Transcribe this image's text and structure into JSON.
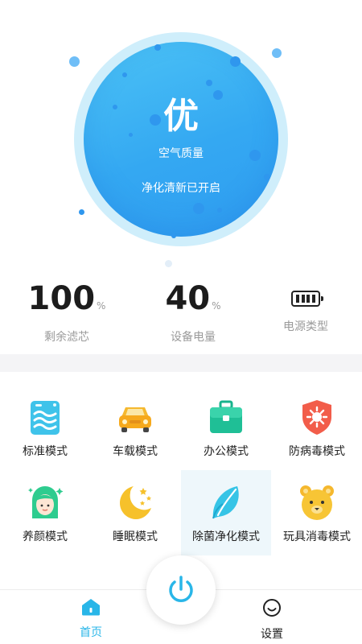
{
  "hero": {
    "quality_grade": "优",
    "quality_label": "空气质量",
    "purify_status": "净化清新已开启"
  },
  "stats": [
    {
      "value": "100",
      "unit": "%",
      "label": "剩余滤芯"
    },
    {
      "value": "40",
      "unit": "%",
      "label": "设备电量"
    },
    {
      "icon": "battery-icon",
      "label": "电源类型"
    }
  ],
  "modes": [
    {
      "label": "标准模式",
      "icon": "standard-mode-icon"
    },
    {
      "label": "车载模式",
      "icon": "car-icon"
    },
    {
      "label": "办公模式",
      "icon": "briefcase-icon"
    },
    {
      "label": "防病毒模式",
      "icon": "virus-shield-icon"
    },
    {
      "label": "养颜模式",
      "icon": "beauty-face-icon"
    },
    {
      "label": "睡眠模式",
      "icon": "moon-stars-icon"
    },
    {
      "label": "除菌净化模式",
      "icon": "leaf-icon",
      "selected": true
    },
    {
      "label": "玩具消毒模式",
      "icon": "teddy-bear-icon"
    }
  ],
  "nav": {
    "home_label": "首页",
    "settings_label": "设置"
  },
  "colors": {
    "accent": "#29b6e8",
    "orb": "#3aaef3"
  }
}
